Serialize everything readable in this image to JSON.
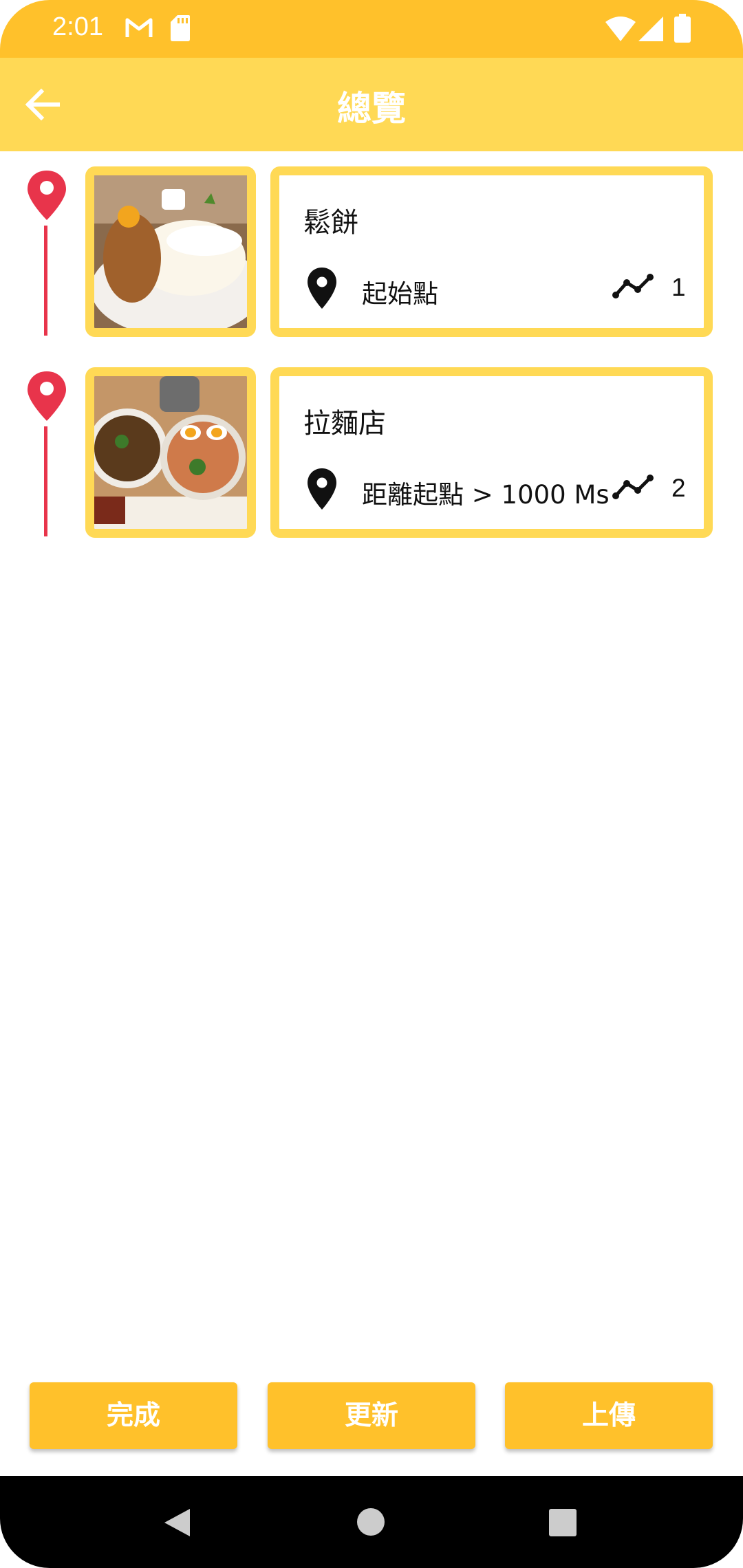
{
  "status_bar": {
    "time": "2:01",
    "icons": [
      "gmail-icon",
      "sd-card-icon",
      "wifi-icon",
      "signal-icon",
      "battery-icon"
    ]
  },
  "app_bar": {
    "title": "總覽",
    "back_icon": "arrow-back-icon"
  },
  "stops": [
    {
      "name": "鬆餅",
      "distance": "起始點",
      "order": "1",
      "image": "soufflé pancakes with mont blanc photo"
    },
    {
      "name": "拉麵店",
      "distance": "距離起點 > 1000 Ms",
      "order": "2",
      "image": "ramen and dipping noodles photo"
    }
  ],
  "buttons": {
    "done": "完成",
    "update": "更新",
    "upload": "上傳"
  },
  "colors": {
    "status_bar": "#FFC12B",
    "app_bar": "#FFD955",
    "frame": "#FFD955",
    "button": "#FFC12B",
    "pin": "#E8344B"
  },
  "nav_bar": {
    "icons": [
      "nav-back-icon",
      "nav-home-icon",
      "nav-recents-icon"
    ]
  }
}
